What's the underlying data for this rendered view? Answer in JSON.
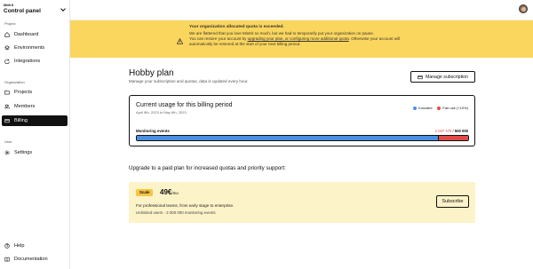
{
  "app": {
    "small_title": "MinKit",
    "title": "Control panel"
  },
  "sidebar": {
    "sections": [
      {
        "label": "Project"
      },
      {
        "label": "Organization"
      },
      {
        "label": "User"
      }
    ],
    "items": [
      {
        "label": "Dashboard",
        "icon": "home-icon"
      },
      {
        "label": "Environments",
        "icon": "layers-icon"
      },
      {
        "label": "Integrations",
        "icon": "refresh-icon"
      },
      {
        "label": "Projects",
        "icon": "folder-icon"
      },
      {
        "label": "Members",
        "icon": "users-icon"
      },
      {
        "label": "Billing",
        "icon": "card-icon",
        "active": true
      },
      {
        "label": "Settings",
        "icon": "gear-icon"
      },
      {
        "label": "Help",
        "icon": "help-icon"
      },
      {
        "label": "Documentation",
        "icon": "book-icon"
      }
    ]
  },
  "banner": {
    "title": "Your organization allocated quota is exceeded.",
    "line1": "We are flattered that you love MinKit so much, but we had to temporarily put your organization on pause.",
    "line2_pre": "You can restore your account by ",
    "line2_link": "upgrading your plan, or configuring more additional quota",
    "line2_post": ". Otherwise your account will",
    "line3": "automatically be restored at the start of your next billing period.",
    "color": "#fbd65e"
  },
  "main": {
    "title": "Hobby plan",
    "subtitle": "Manage your subscription and quotas, data is updated every hour.",
    "manage_button": "Manage subscription"
  },
  "usage": {
    "title": "Current usage for this billing period",
    "date_range": "April 8th, 2023 to May 8th, 2023",
    "legend_included": "Included",
    "legend_fair": "Fair use (+10%)",
    "included_color": "#4a90e2",
    "fair_color": "#e24a4a",
    "metric_label": "Monitoring events",
    "metric_used": "1 047 470",
    "metric_sep": " / ",
    "metric_quota": "500 000",
    "included_fraction": 0.91,
    "fair_fraction": 0.09
  },
  "upgrade": {
    "heading": "Upgrade to a paid plan for increased quotas and priority support:",
    "plan": {
      "badge": "Scale",
      "price": "49€",
      "per": "/mo",
      "desc": "For professional teams, from early stage to enterprise.",
      "features": "Unlimited users - 3 000 000 monitoring events",
      "button": "Subscribe"
    }
  }
}
